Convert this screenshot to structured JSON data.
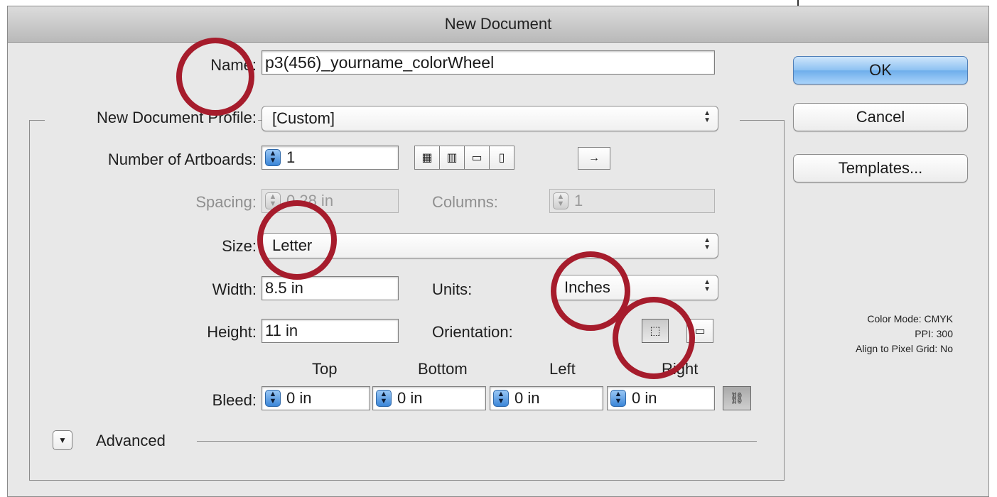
{
  "dialog": {
    "title": "New Document",
    "name_label": "Name:",
    "name_value": "p3(456)_yourname_colorWheel",
    "profile_label": "New Document Profile:",
    "profile_value": "[Custom]",
    "artboards_label": "Number of Artboards:",
    "artboards_value": "1",
    "spacing_label": "Spacing:",
    "spacing_value": "0.28 in",
    "columns_label": "Columns:",
    "columns_value": "1",
    "size_label": "Size:",
    "size_value": "Letter",
    "width_label": "Width:",
    "width_value": "8.5 in",
    "units_label": "Units:",
    "units_value": "Inches",
    "height_label": "Height:",
    "height_value": "11 in",
    "orientation_label": "Orientation:",
    "bleed_label": "Bleed:",
    "bleed_top_label": "Top",
    "bleed_bottom_label": "Bottom",
    "bleed_left_label": "Left",
    "bleed_right_label": "Right",
    "bleed_top": "0 in",
    "bleed_bottom": "0 in",
    "bleed_left": "0 in",
    "bleed_right": "0 in",
    "advanced_label": "Advanced"
  },
  "buttons": {
    "ok": "OK",
    "cancel": "Cancel",
    "templates": "Templates..."
  },
  "info": {
    "color_mode": "Color Mode: CMYK",
    "ppi": "PPI: 300",
    "align": "Align to Pixel Grid: No"
  },
  "colors": {
    "annotation_circle": "#a61c2c",
    "default_button": "#8dc1f2"
  }
}
